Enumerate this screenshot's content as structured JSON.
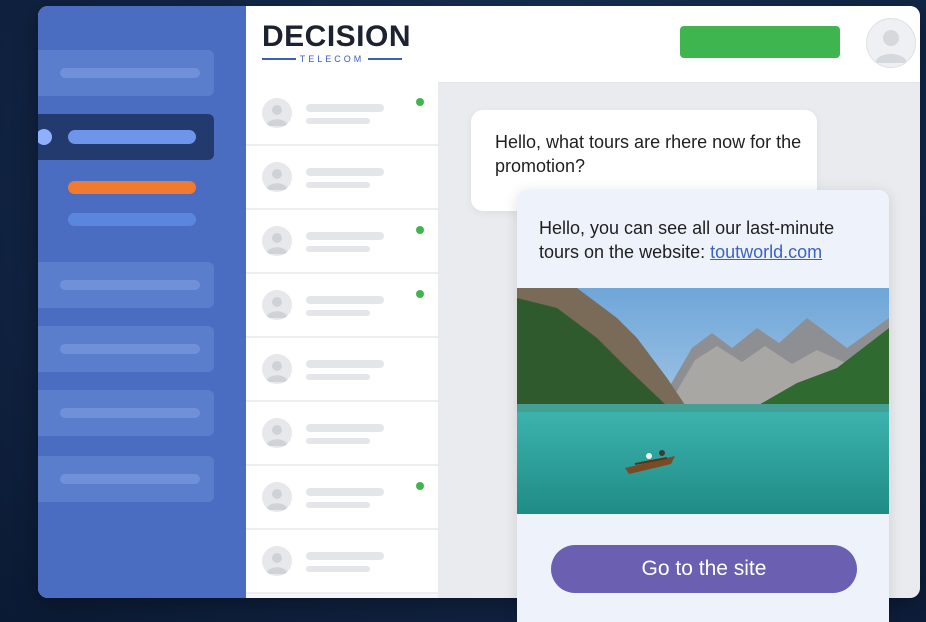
{
  "brand": {
    "name": "DECISION",
    "subname": "TELECOM"
  },
  "colors": {
    "sidebar": "#4a6dc1",
    "accent_orange": "#f07a30",
    "accent_blue": "#5b86de",
    "online_green": "#3fb54f",
    "button_purple": "#6a5fb0",
    "link_blue": "#3b62c4"
  },
  "header": {
    "action_button_color": "#3fb54f",
    "profile_icon": "user-avatar-icon"
  },
  "contacts": [
    {
      "online": true
    },
    {
      "online": false
    },
    {
      "online": true
    },
    {
      "online": true
    },
    {
      "online": false
    },
    {
      "online": false
    },
    {
      "online": true
    },
    {
      "online": false
    }
  ],
  "chat": {
    "incoming_message": "Hello, what tours are rhere now for the promotion?",
    "reply_message_prefix": "Hello, you can see all our last-minute tours on the website: ",
    "reply_link": "toutworld.com",
    "image_icon": "mountain-lake-photo",
    "cta_label": "Go to the site"
  }
}
